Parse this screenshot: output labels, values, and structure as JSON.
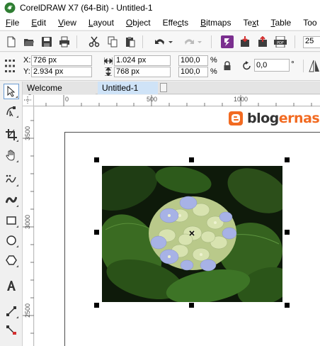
{
  "window": {
    "title": "CorelDRAW X7 (64-Bit) - Untitled-1"
  },
  "menu": [
    {
      "pre": "",
      "ul": "F",
      "post": "ile"
    },
    {
      "pre": "",
      "ul": "E",
      "post": "dit"
    },
    {
      "pre": "",
      "ul": "V",
      "post": "iew"
    },
    {
      "pre": "",
      "ul": "L",
      "post": "ayout"
    },
    {
      "pre": "",
      "ul": "O",
      "post": "bject"
    },
    {
      "pre": "Effe",
      "ul": "c",
      "post": "ts"
    },
    {
      "pre": "",
      "ul": "B",
      "post": "itmaps"
    },
    {
      "pre": "Te",
      "ul": "x",
      "post": "t"
    },
    {
      "pre": "",
      "ul": "T",
      "post": "able"
    },
    {
      "pre": "Too",
      "ul": "",
      "post": ""
    }
  ],
  "toolbar": {
    "zoom_partial": "25"
  },
  "propbar": {
    "x_label": "X:",
    "x_value": "726 px",
    "y_label": "Y:",
    "y_value": "2.934 px",
    "w_value": "1.024 px",
    "h_value": "768 px",
    "sx_value": "100,0",
    "sy_value": "100,0",
    "pct1": "%",
    "pct2": "%",
    "rotate_value": "0,0",
    "degree": "°"
  },
  "tabs": {
    "welcome": "Welcome Screen",
    "doc": "Untitled-1"
  },
  "ruler": {
    "h_labels": [
      "0",
      "500",
      "1000"
    ],
    "v_labels": [
      "3500",
      "3000",
      "2500"
    ]
  },
  "watermark": {
    "part1": "blog",
    "part2": "ernas"
  },
  "colors": {
    "accent": "#f26a21",
    "tab_active": "#cfe3f7",
    "selection_blue": "#6b9bd1"
  }
}
